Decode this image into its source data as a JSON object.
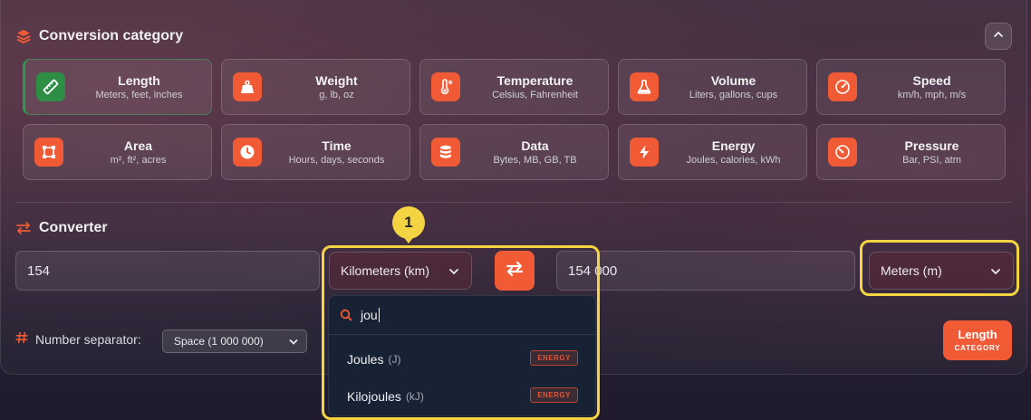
{
  "category_section": {
    "title": "Conversion category",
    "icon": "layers-icon",
    "collapse_icon": "chevron-up-icon",
    "categories": [
      {
        "title": "Length",
        "subtitle": "Meters, feet, inches",
        "icon": "ruler-icon",
        "active": true
      },
      {
        "title": "Weight",
        "subtitle": "g, lb, oz",
        "icon": "weight-icon"
      },
      {
        "title": "Temperature",
        "subtitle": "Celsius, Fahrenheit",
        "icon": "thermometer-icon"
      },
      {
        "title": "Volume",
        "subtitle": "Liters, gallons, cups",
        "icon": "flask-icon"
      },
      {
        "title": "Speed",
        "subtitle": "km/h, mph, m/s",
        "icon": "speedometer-icon"
      },
      {
        "title": "Area",
        "subtitle": "m², ft², acres",
        "icon": "area-icon"
      },
      {
        "title": "Time",
        "subtitle": "Hours, days, seconds",
        "icon": "clock-icon"
      },
      {
        "title": "Data",
        "subtitle": "Bytes, MB, GB, TB",
        "icon": "database-icon"
      },
      {
        "title": "Energy",
        "subtitle": "Joules, calories, kWh",
        "icon": "bolt-icon"
      },
      {
        "title": "Pressure",
        "subtitle": "Bar, PSI, atm",
        "icon": "gauge-icon"
      }
    ]
  },
  "converter": {
    "title": "Converter",
    "icon": "swap-arrows-icon",
    "from_value": "154",
    "from_unit": "Kilometers (km)",
    "to_value": "154 000",
    "to_unit": "Meters (m)",
    "marker": "1"
  },
  "unit_dropdown": {
    "search_value": "jou",
    "items": [
      {
        "label": "Joules",
        "abbr": "(J)",
        "tag": "ENERGY"
      },
      {
        "label": "Kilojoules",
        "abbr": "(kJ)",
        "tag": "ENERGY"
      }
    ]
  },
  "footer": {
    "separator_label": "Number separator:",
    "separator_value": "Space (1 000 000)",
    "category_badge_title": "Length",
    "category_badge_sub": "CATEGORY"
  },
  "colors": {
    "accent": "#f05a35",
    "active": "#2f8e45",
    "highlight": "#f5d443"
  }
}
